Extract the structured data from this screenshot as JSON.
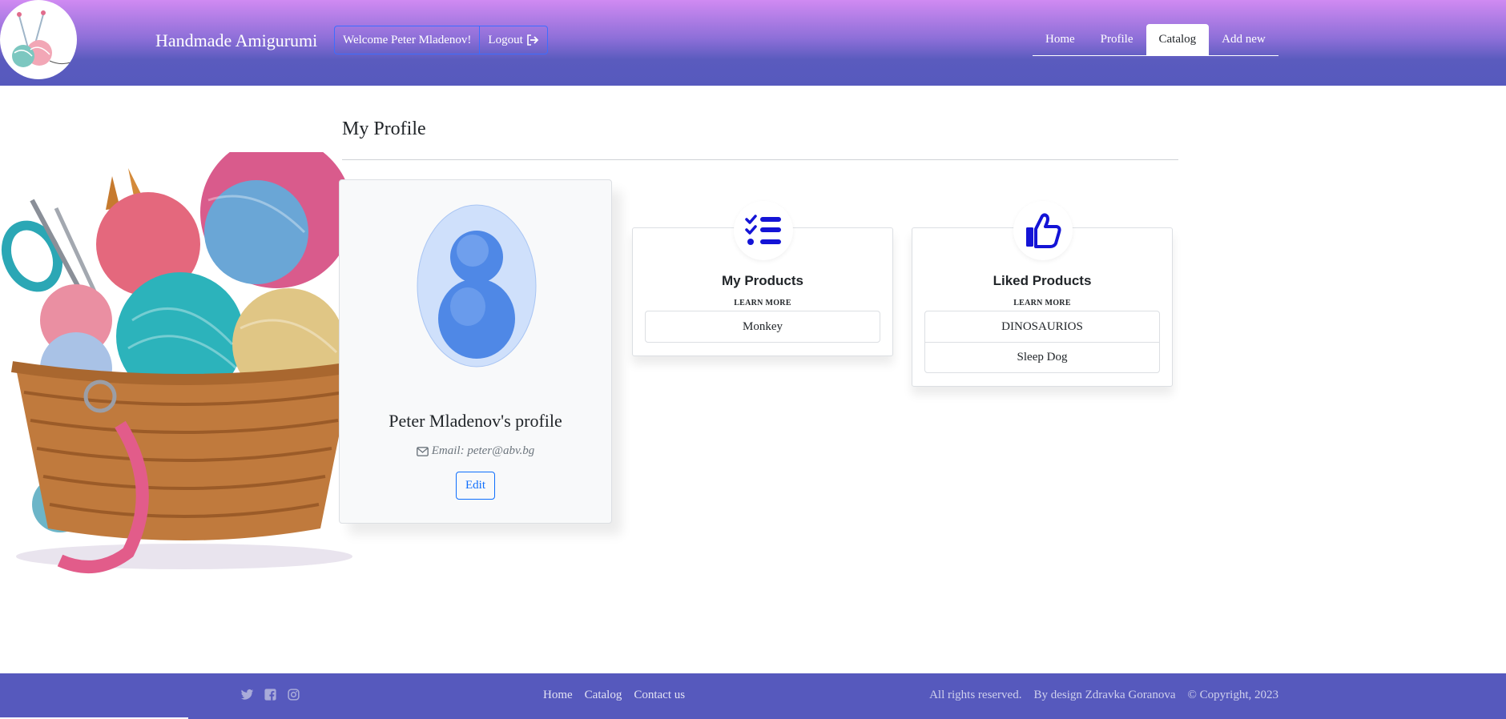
{
  "header": {
    "brand": "Handmade Amigurumi",
    "welcome": "Welcome Peter Mladenov!",
    "logout": "Logout",
    "nav": [
      {
        "label": "Home",
        "active": false
      },
      {
        "label": "Profile",
        "active": false
      },
      {
        "label": "Catalog",
        "active": true
      },
      {
        "label": "Add new",
        "active": false
      }
    ]
  },
  "main": {
    "title": "My Profile",
    "profile": {
      "name": "Peter Mladenov's profile",
      "email": "Email: peter@abv.bg",
      "edit": "Edit"
    },
    "cards": [
      {
        "title": "My Products",
        "subtitle": "LEARN MORE",
        "icon": "checklist-icon",
        "items": [
          "Monkey"
        ]
      },
      {
        "title": "Liked Products",
        "subtitle": "LEARN MORE",
        "icon": "thumbs-up-icon",
        "items": [
          "DINOSAURIOS",
          "Sleep Dog"
        ]
      }
    ]
  },
  "footer": {
    "socials": [
      "twitter-icon",
      "facebook-icon",
      "instagram-icon"
    ],
    "links": [
      "Home",
      "Catalog",
      "Contact us"
    ],
    "rights": "All rights reserved.",
    "design": "By design Zdravka Goranova",
    "copyright": "© Copyright, 2023"
  },
  "colors": {
    "header_top": "#d08af2",
    "header_bottom": "#5659bd",
    "footer": "#5659bd",
    "icon_blue": "#1414d6",
    "button_blue": "#0d6efd"
  }
}
